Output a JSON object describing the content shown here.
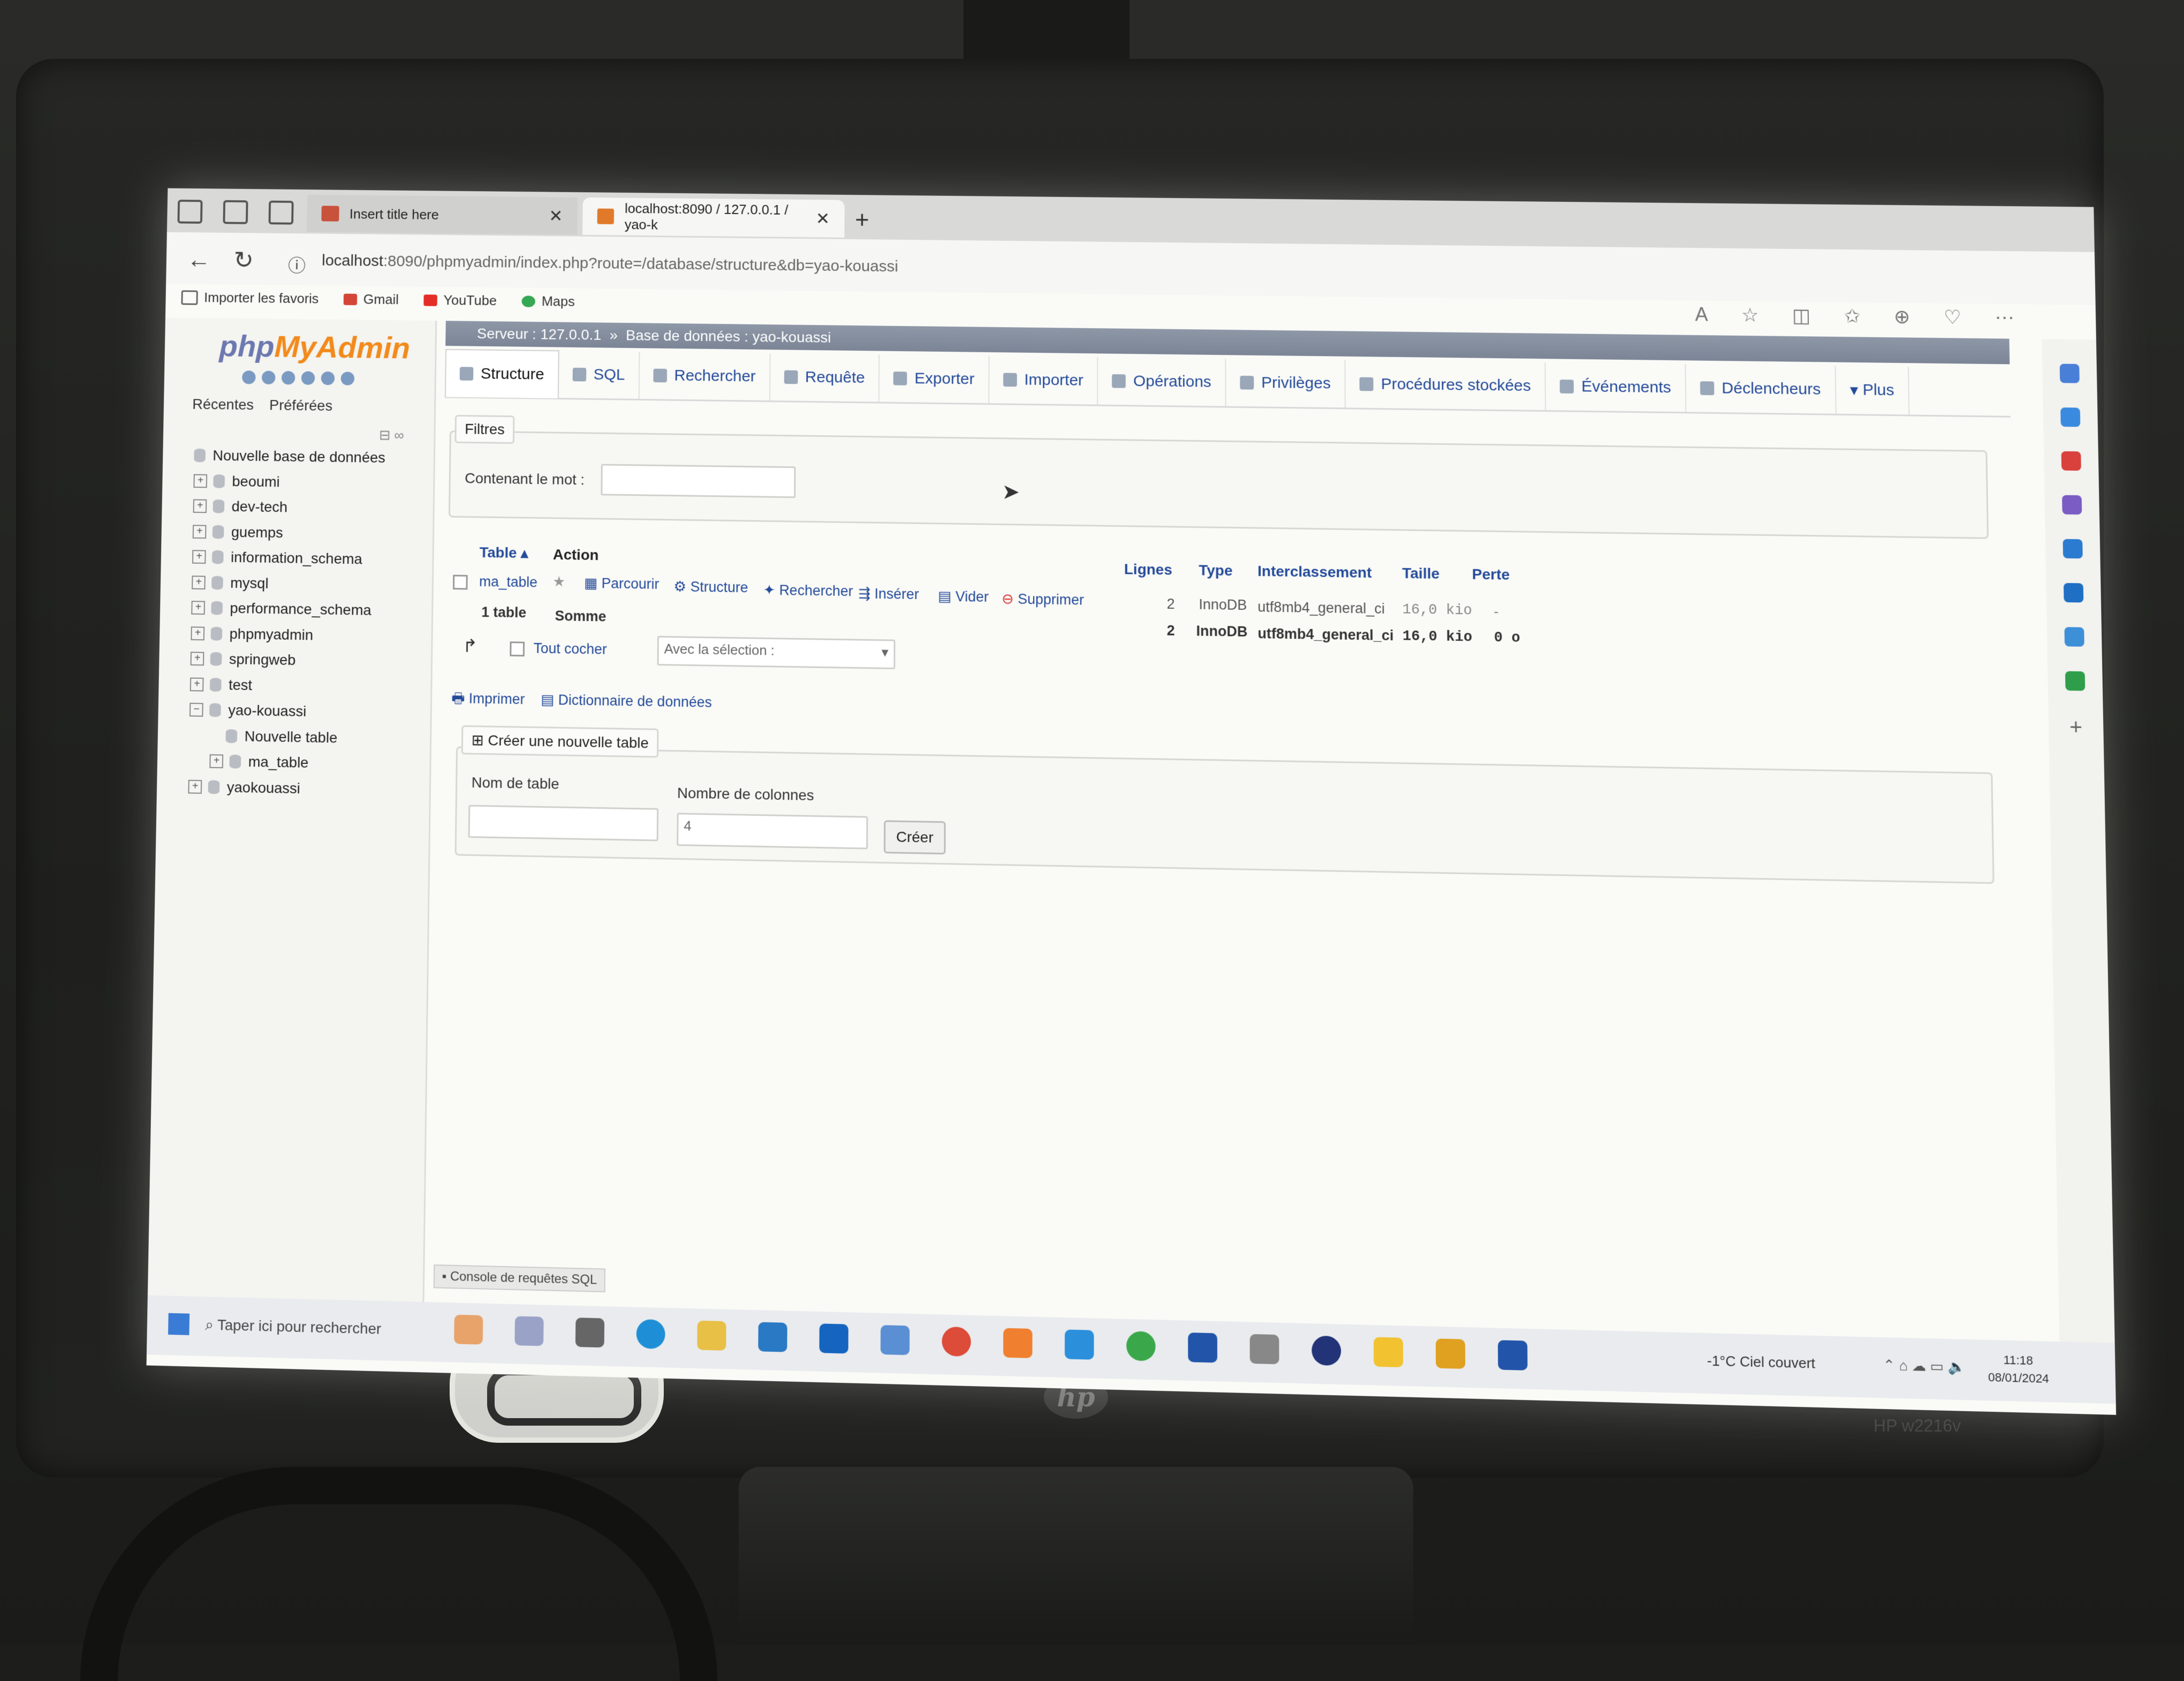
{
  "browser": {
    "tabs": [
      {
        "title": "Insert title here",
        "active": false
      },
      {
        "title": "localhost:8090 / 127.0.0.1 / yao-k",
        "active": true
      }
    ],
    "url_host": "localhost",
    "url_path": ":8090/phpmyadmin/index.php?route=/database/structure&db=yao-kouassi",
    "bookmarks": [
      "Importer les favoris",
      "Gmail",
      "YouTube",
      "Maps"
    ],
    "new_tab": "+"
  },
  "pma": {
    "logo_php": "php",
    "logo_myadmin": "MyAdmin",
    "subtabs": [
      "Récentes",
      "Préférées"
    ],
    "tree": [
      {
        "label": "Nouvelle base de données",
        "indent": 0
      },
      {
        "label": "beoumi",
        "indent": 0
      },
      {
        "label": "dev-tech",
        "indent": 0
      },
      {
        "label": "guemps",
        "indent": 0
      },
      {
        "label": "information_schema",
        "indent": 0
      },
      {
        "label": "mysql",
        "indent": 0
      },
      {
        "label": "performance_schema",
        "indent": 0
      },
      {
        "label": "phpmyadmin",
        "indent": 0
      },
      {
        "label": "springweb",
        "indent": 0
      },
      {
        "label": "test",
        "indent": 0
      },
      {
        "label": "yao-kouassi",
        "indent": 0
      },
      {
        "label": "Nouvelle table",
        "indent": 1
      },
      {
        "label": "ma_table",
        "indent": 1
      },
      {
        "label": "yaokouassi",
        "indent": 0
      }
    ],
    "breadcrumb_server": "Serveur : 127.0.0.1",
    "breadcrumb_sep": "»",
    "breadcrumb_db": "Base de données : yao-kouassi",
    "tabs": [
      "Structure",
      "SQL",
      "Rechercher",
      "Requête",
      "Exporter",
      "Importer",
      "Opérations",
      "Privilèges",
      "Procédures stockées",
      "Événements",
      "Déclencheurs",
      "Plus"
    ],
    "filters_legend": "Filtres",
    "filter_label": "Contenant le mot :",
    "table_headers": {
      "table": "Table",
      "action": "Action",
      "rows": "Lignes",
      "type": "Type",
      "collation": "Interclassement",
      "size": "Taille",
      "overhead": "Perte"
    },
    "row": {
      "name": "ma_table",
      "actions": [
        "Parcourir",
        "Structure",
        "Rechercher",
        "Insérer",
        "Vider",
        "Supprimer"
      ],
      "rows": "2",
      "type": "InnoDB",
      "collation": "utf8mb4_general_ci",
      "size": "16,0 kio",
      "overhead": "-"
    },
    "sum": {
      "label": "1 table",
      "sum_label": "Somme",
      "rows": "2",
      "type": "InnoDB",
      "collation": "utf8mb4_general_ci",
      "size": "16,0 kio",
      "overhead": "0 o"
    },
    "check_all": "Tout cocher",
    "with_selection": "Avec la sélection :",
    "print": "Imprimer",
    "data_dictionary": "Dictionnaire de données",
    "create_legend": "Créer une nouvelle table",
    "table_name_label": "Nom de table",
    "columns_label": "Nombre de colonnes",
    "columns_value": "4",
    "create_button": "Créer",
    "console": "Console de requêtes SQL"
  },
  "taskbar": {
    "search_placeholder": "Taper ici pour rechercher",
    "weather": "-1°C  Ciel couvert",
    "time": "11:18",
    "date": "08/01/2024"
  },
  "monitor": {
    "brand": "hp",
    "model": "HP w2216v"
  }
}
